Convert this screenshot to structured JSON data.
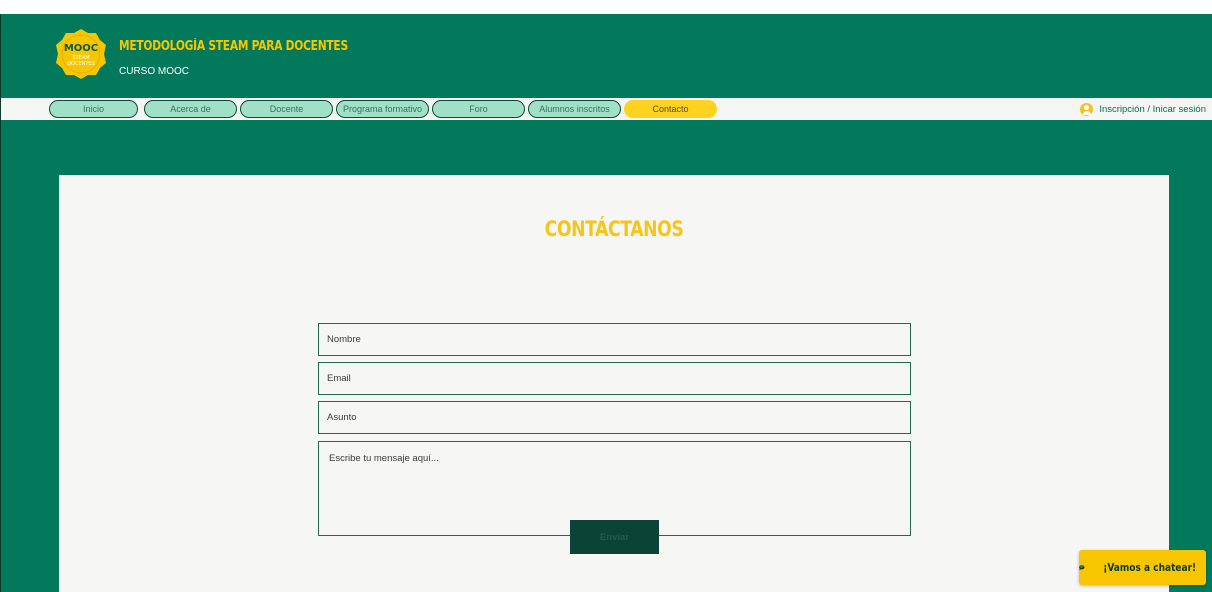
{
  "header": {
    "logo": {
      "line1": "MOOC",
      "line2": "STEAM",
      "line3": "DOCENTES"
    },
    "title": "METODOLOGÍA STEAM PARA DOCENTES",
    "subtitle": "CURSO MOOC"
  },
  "nav": {
    "items": [
      {
        "label": "Inicio"
      },
      {
        "label": "Acerca de"
      },
      {
        "label": "Docente"
      },
      {
        "label": "Programa formativo"
      },
      {
        "label": "Foro"
      },
      {
        "label": "Alumnos inscritos"
      },
      {
        "label": "Contacto"
      }
    ],
    "active": "Contacto",
    "login_label": "Inscripción / Inicar sesión"
  },
  "contact": {
    "title": "CONTÁCTANOS",
    "name_placeholder": "Nombre",
    "email_placeholder": "Email",
    "subject_placeholder": "Asunto",
    "message_placeholder": "Escribe tu mensaje aquí...",
    "send_label": "Enviar"
  },
  "chat": {
    "label": "¡Vamos a chatear!"
  },
  "colors": {
    "brand_green": "#03795c",
    "accent_yellow": "#f7c600",
    "nav_pill": "#9fe0c7",
    "dark_green": "#0b4436"
  }
}
